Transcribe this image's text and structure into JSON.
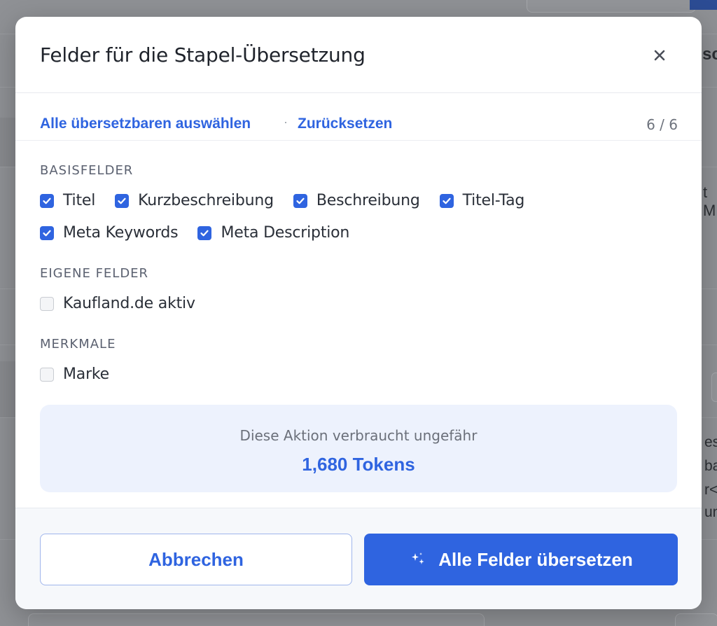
{
  "colors": {
    "accent": "#2f64e0",
    "info_bg": "#edf2fd",
    "overlay": "#8f9195"
  },
  "background": {
    "fragment_top_right": "sc",
    "fragment_mid_right": "t M",
    "snippets": [
      "es",
      "ba",
      "r</",
      "un"
    ]
  },
  "dialog": {
    "title": "Felder für die Stapel-Übersetzung",
    "close_icon": "close-icon",
    "toolbar": {
      "select_all_label": "Alle übersetzbaren auswählen",
      "separator": "·",
      "reset_label": "Zurücksetzen",
      "count": "6 / 6"
    },
    "sections": [
      {
        "heading": "BASISFELDER",
        "fields": [
          {
            "label": "Titel",
            "checked": true
          },
          {
            "label": "Kurzbeschreibung",
            "checked": true
          },
          {
            "label": "Beschreibung",
            "checked": true
          },
          {
            "label": "Titel-Tag",
            "checked": true
          },
          {
            "label": "Meta Keywords",
            "checked": true
          },
          {
            "label": "Meta Description",
            "checked": true
          }
        ]
      },
      {
        "heading": "EIGENE FELDER",
        "fields": [
          {
            "label": "Kaufland.de aktiv",
            "checked": false
          }
        ]
      },
      {
        "heading": "MERKMALE",
        "fields": [
          {
            "label": "Marke",
            "checked": false
          }
        ]
      }
    ],
    "info": {
      "text": "Diese Aktion verbraucht ungefähr",
      "tokens": "1,680 Tokens"
    },
    "footer": {
      "cancel_label": "Abbrechen",
      "primary_label": "Alle Felder übersetzen",
      "primary_icon": "sparkles-icon"
    }
  }
}
